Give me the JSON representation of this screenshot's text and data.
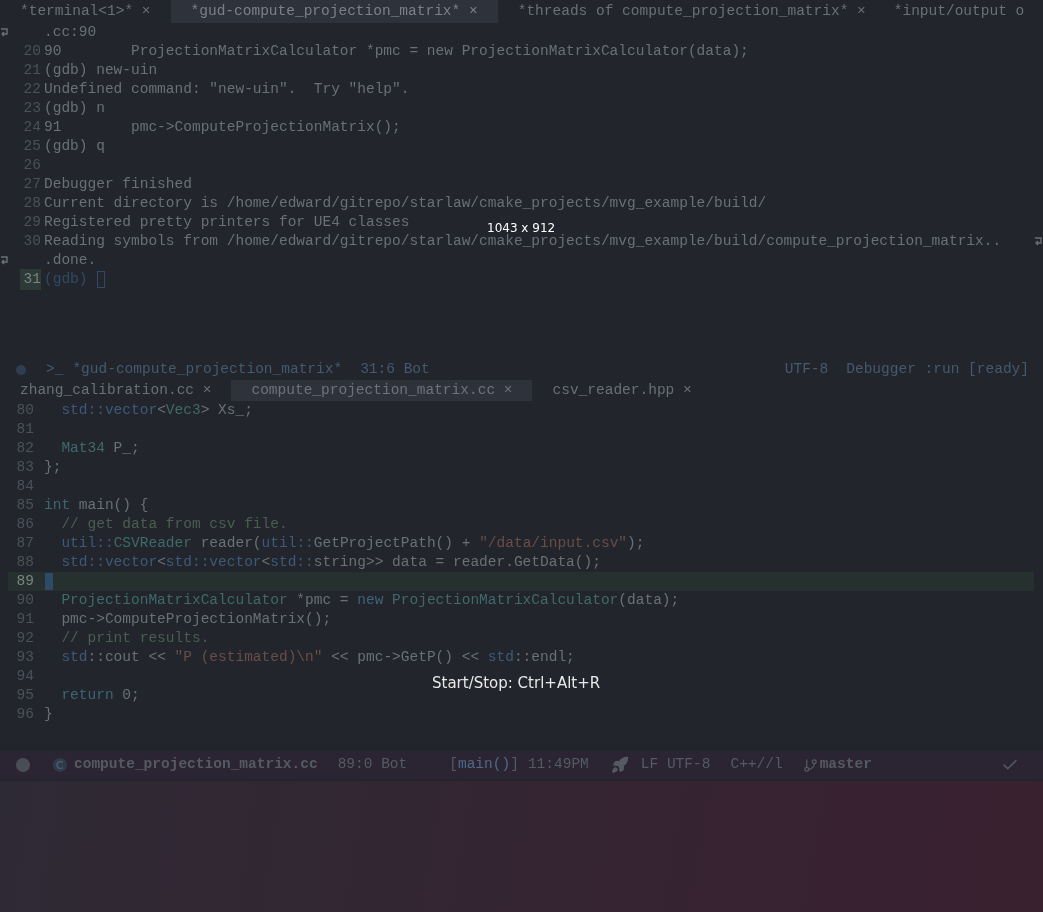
{
  "top_tabs": [
    {
      "label": "*terminal<1>* ×",
      "selected": false
    },
    {
      "label": "*gud-compute_projection_matrix* ×",
      "selected": true
    },
    {
      "label": "*threads of compute_projection_matrix* ×",
      "selected": false
    },
    {
      "label": "*input/output o",
      "selected": false
    }
  ],
  "terminal": {
    "lines": [
      {
        "kind": "continuation",
        "text": ".cc:90"
      },
      {
        "kind": "output",
        "number": "20",
        "text": "90        ProjectionMatrixCalculator *pmc = new ProjectionMatrixCalculator(data);"
      },
      {
        "kind": "output",
        "number": "21",
        "text": "(gdb) new-uin"
      },
      {
        "kind": "output",
        "number": "22",
        "text": "Undefined command: \"new-uin\".  Try \"help\"."
      },
      {
        "kind": "output",
        "number": "23",
        "text": "(gdb) n"
      },
      {
        "kind": "output",
        "number": "24",
        "text": "91        pmc->ComputeProjectionMatrix();"
      },
      {
        "kind": "output",
        "number": "25",
        "text": "(gdb) q"
      },
      {
        "kind": "output",
        "number": "26"
      },
      {
        "kind": "output",
        "number": "27",
        "text": "Debugger finished"
      },
      {
        "kind": "output",
        "number": "28",
        "text": "Current directory is /home/edward/gitrepo/starlaw/cmake_projects/mvg_example/build/"
      },
      {
        "kind": "output",
        "number": "29",
        "text": "Registered pretty printers for UE4 classes"
      },
      {
        "kind": "wrapped",
        "number": "30",
        "text": "Reading symbols from /home/edward/gitrepo/starlaw/cmake_projects/mvg_example/build/compute_projection_matrix.."
      },
      {
        "kind": "continuation",
        "text": ".done."
      },
      {
        "kind": "prompt",
        "number": "31",
        "text": "(gdb)"
      }
    ]
  },
  "mode_line": {
    "prompt_glyph": ">_",
    "buffer": "*gud-compute_projection_matrix*",
    "position": "31:6 Bot",
    "encoding": "UTF-8",
    "mode": "Debugger :run [ready]"
  },
  "file_tabs": [
    {
      "label": "zhang_calibration.cc ×",
      "selected": false
    },
    {
      "label": "compute_projection_matrix.cc ×",
      "selected": true
    },
    {
      "label": "csv_reader.hpp ×",
      "selected": false
    }
  ],
  "code": {
    "lines": [
      {
        "number": "80",
        "current": false,
        "segments": [
          {
            "text": "  std::vector",
            "kind": "namespace"
          },
          {
            "text": "<",
            "kind": "plain"
          },
          {
            "text": "Vec3",
            "kind": "type"
          },
          {
            "text": "> Xs_;",
            "kind": "plain"
          }
        ]
      },
      {
        "number": "81",
        "current": false
      },
      {
        "number": "82",
        "current": false,
        "segments": [
          {
            "text": "  Mat34",
            "kind": "type"
          },
          {
            "text": " P_;",
            "kind": "plain"
          }
        ]
      },
      {
        "number": "83",
        "current": false,
        "segments": [
          {
            "text": "};",
            "kind": "plain"
          }
        ]
      },
      {
        "number": "84",
        "current": false
      },
      {
        "number": "85",
        "current": false,
        "segments": [
          {
            "text": "int",
            "kind": "keyword"
          },
          {
            "text": " main() {",
            "kind": "plain"
          }
        ]
      },
      {
        "number": "86",
        "current": false,
        "segments": [
          {
            "text": "  // get data from csv file.",
            "kind": "comment"
          }
        ]
      },
      {
        "number": "87",
        "current": false,
        "segments": [
          {
            "text": "  util::",
            "kind": "namespace"
          },
          {
            "text": "CSVReader",
            "kind": "type"
          },
          {
            "text": " reader(",
            "kind": "plain"
          },
          {
            "text": "util::",
            "kind": "namespace"
          },
          {
            "text": "GetProjectPath() + ",
            "kind": "plain"
          },
          {
            "text": "\"/data/input.csv\"",
            "kind": "string"
          },
          {
            "text": ");",
            "kind": "plain"
          }
        ]
      },
      {
        "number": "88",
        "current": false,
        "segments": [
          {
            "text": "  std::vector",
            "kind": "namespace"
          },
          {
            "text": "<",
            "kind": "plain"
          },
          {
            "text": "std::vector",
            "kind": "namespace"
          },
          {
            "text": "<",
            "kind": "plain"
          },
          {
            "text": "std::",
            "kind": "namespace"
          },
          {
            "text": "string>> data = reader.GetData();",
            "kind": "plain"
          }
        ]
      },
      {
        "number": "89",
        "current": true
      },
      {
        "number": "90",
        "current": false,
        "segments": [
          {
            "text": "  ProjectionMatrixCalculator",
            "kind": "type"
          },
          {
            "text": " *pmc = ",
            "kind": "plain"
          },
          {
            "text": "new",
            "kind": "keyword"
          },
          {
            "text": " ProjectionMatrixCalculator",
            "kind": "type"
          },
          {
            "text": "(data);",
            "kind": "plain"
          }
        ]
      },
      {
        "number": "91",
        "current": false,
        "segments": [
          {
            "text": "  pmc->ComputeProjectionMatrix();",
            "kind": "plain"
          }
        ]
      },
      {
        "number": "92",
        "current": false,
        "segments": [
          {
            "text": "  // print results.",
            "kind": "comment"
          }
        ]
      },
      {
        "number": "93",
        "current": false,
        "segments": [
          {
            "text": "  std",
            "kind": "namespace"
          },
          {
            "text": "::cout << ",
            "kind": "plain"
          },
          {
            "text": "\"P (estimated)\\n\"",
            "kind": "string"
          },
          {
            "text": " << pmc->GetP() << ",
            "kind": "plain"
          },
          {
            "text": "std",
            "kind": "namespace"
          },
          {
            "text": "::endl;",
            "kind": "plain"
          }
        ]
      },
      {
        "number": "94",
        "current": false
      },
      {
        "number": "95",
        "current": false,
        "segments": [
          {
            "text": "  return",
            "kind": "keyword"
          },
          {
            "text": " 0;",
            "kind": "plain"
          }
        ]
      },
      {
        "number": "96",
        "current": false,
        "segments": [
          {
            "text": "}",
            "kind": "plain"
          }
        ]
      }
    ]
  },
  "status_bar": {
    "file": "compute_projection_matrix.cc",
    "position": "89:0 Bot",
    "function_open": "[",
    "function": "main()",
    "function_close": "]",
    "time": "11:49PM",
    "line_encoding": "LF UTF-8",
    "mode": "C++//l",
    "branch": "master"
  },
  "recorder_overlay": {
    "size_label": "1043 x 912",
    "hint": "Start/Stop: Ctrl+Alt+R"
  }
}
